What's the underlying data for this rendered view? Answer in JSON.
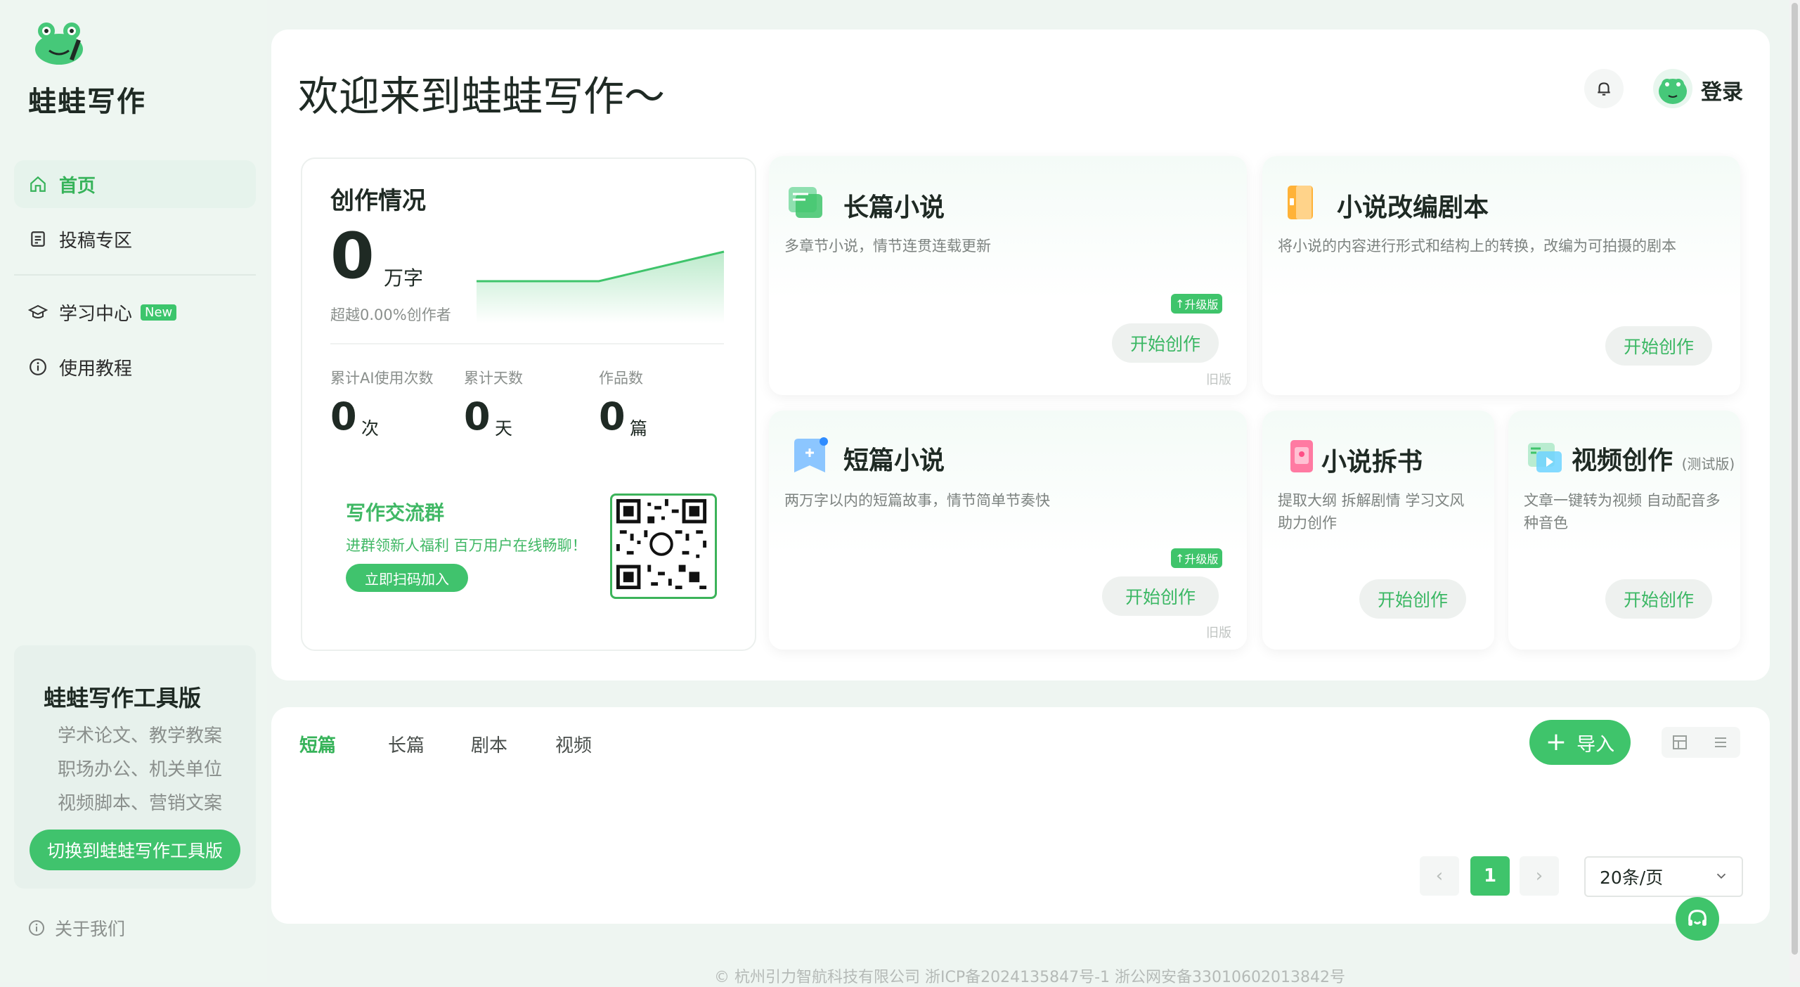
{
  "app": {
    "name": "蛙蛙写作"
  },
  "sidebar": {
    "items": [
      {
        "label": "首页",
        "icon": "home-icon"
      },
      {
        "label": "投稿专区",
        "icon": "document-icon"
      },
      {
        "label": "学习中心",
        "icon": "graduation-cap-icon",
        "badge": "New"
      },
      {
        "label": "使用教程",
        "icon": "info-icon"
      }
    ],
    "promo": {
      "title": "蛙蛙写作工具版",
      "lines": [
        "学术论文、教学教案",
        "职场办公、机关单位",
        "视频脚本、营销文案"
      ],
      "button": "切换到蛙蛙写作工具版"
    },
    "about": "关于我们"
  },
  "header": {
    "welcome": "欢迎来到蛙蛙写作～",
    "login": "登录"
  },
  "stats": {
    "title": "创作情况",
    "words": "0",
    "words_unit": "万字",
    "beyond": "超越0.00%创作者",
    "items": [
      {
        "label": "累计AI使用次数",
        "value": "0",
        "unit": "次"
      },
      {
        "label": "累计天数",
        "value": "0",
        "unit": "天"
      },
      {
        "label": "作品数",
        "value": "0",
        "unit": "篇"
      }
    ],
    "group": {
      "title": "写作交流群",
      "subtitle": "进群领新人福利 百万用户在线畅聊！",
      "button": "立即扫码加入"
    }
  },
  "features": {
    "long_novel": {
      "title": "长篇小说",
      "desc": "多章节小说，情节连贯连载更新",
      "badge": "升级版",
      "button": "开始创作",
      "old": "旧版"
    },
    "adapt_script": {
      "title": "小说改编剧本",
      "desc": "将小说的内容进行形式和结构上的转换，改编为可拍摄的剧本",
      "button": "开始创作"
    },
    "short_novel": {
      "title": "短篇小说",
      "desc": "两万字以内的短篇故事，情节简单节奏快",
      "badge": "升级版",
      "button": "开始创作",
      "old": "旧版"
    },
    "split_book": {
      "title": "小说拆书",
      "desc": "提取大纲 拆解剧情 学习文风 助力创作",
      "button": "开始创作"
    },
    "video": {
      "title": "视频创作",
      "tag": "(测试版)",
      "desc": "文章一键转为视频 自动配音多种音色",
      "button": "开始创作"
    }
  },
  "works": {
    "tabs": [
      "短篇",
      "长篇",
      "剧本",
      "视频"
    ],
    "import": "导入",
    "page": "1",
    "page_size": "20条/页"
  },
  "footer": "© 杭州引力智航科技有限公司 浙ICP备2024135847号-1    浙公网安备33010602013842号",
  "colors": {
    "accent": "#3fc46b",
    "background": "#eef5f1"
  }
}
